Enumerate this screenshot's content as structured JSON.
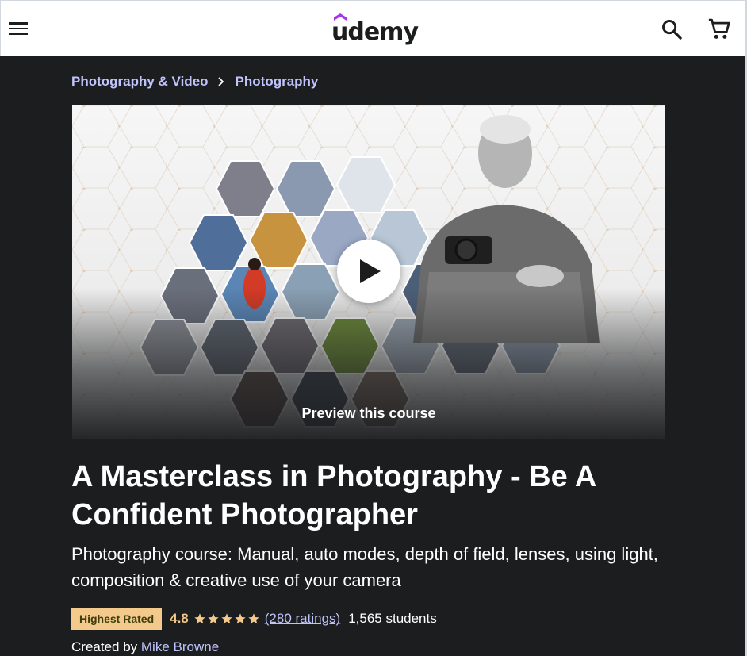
{
  "header": {
    "menu_icon": "hamburger-menu-icon",
    "logo_text": "udemy",
    "search_icon": "search-icon",
    "cart_icon": "cart-icon"
  },
  "breadcrumb": {
    "items": [
      "Photography & Video",
      "Photography"
    ],
    "separator_icon": "chevron-right-icon"
  },
  "preview": {
    "label": "Preview this course",
    "play_icon": "play-icon"
  },
  "course": {
    "title": "A Masterclass in Photography - Be A Confident Photographer",
    "subtitle": "Photography course: Manual, auto modes, depth of field, lenses, using light, composition & creative use of your camera",
    "badge": "Highest Rated",
    "rating": "4.8",
    "stars": 4.8,
    "ratings_link": "(280 ratings)",
    "students": "1,565 students",
    "created_by_label": "Created by",
    "instructor": "Mike Browne"
  },
  "colors": {
    "background": "#1c1d1f",
    "link": "#c0c4fc",
    "badge_bg": "#f3ca8c",
    "rating": "#f3ca8c",
    "header_bg": "#ffffff",
    "logo_accent": "#a435f0"
  }
}
